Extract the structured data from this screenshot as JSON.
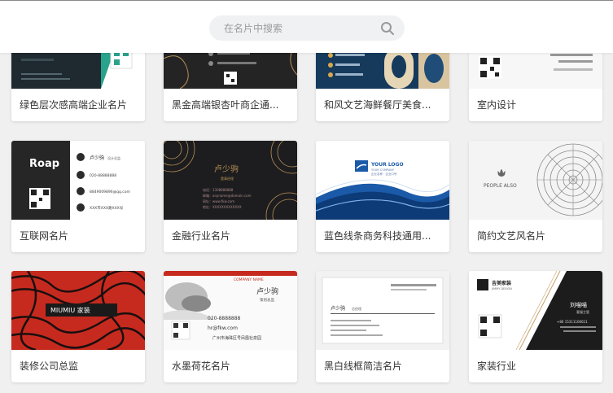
{
  "search": {
    "placeholder": "在名片中搜索"
  },
  "cards": [
    {
      "label": "绿色层次感高端企业名片"
    },
    {
      "label": "黑金高端银杏叶商企通..."
    },
    {
      "label": "和风文艺海鲜餐厅美食..."
    },
    {
      "label": "室内设计"
    },
    {
      "label": "互联网名片",
      "thumb": {
        "logo": "Roap",
        "name": "卢少驹",
        "title": "设计总监",
        "phone": "020-88888888",
        "email": "8849009896@qq.com",
        "address": "XXX市XXX路XXX号"
      }
    },
    {
      "label": "金融行业名片",
      "thumb": {
        "name": "卢少驹",
        "title": "董事经理",
        "phone": "电话：1308888888",
        "email": "邮箱：anyname@domain.com",
        "web": "网址：www.fkw.com",
        "address": "地址：XXXXXXXXXXXXX"
      }
    },
    {
      "label": "蓝色线条商务科技通用...",
      "thumb": {
        "logo": "YOUR LOGO",
        "sub": "YOUR COMPANY",
        "slogan": "企业名称 · 企业口号"
      }
    },
    {
      "label": "简约文艺风名片",
      "thumb": {
        "text": "PEOPLE ALSO"
      }
    },
    {
      "label": "装修公司总监",
      "thumb": {
        "text": "MIUMIU 家装"
      }
    },
    {
      "label": "水墨荷花名片",
      "thumb": {
        "company": "COMPANY NAME",
        "name": "卢少驹",
        "title": "策划总监",
        "phone": "020-8888888",
        "email": "hr@fkw.com",
        "address": "广州市海珠区号凤凰社泉园"
      }
    },
    {
      "label": "黑白线框简洁名片",
      "thumb": {
        "name": "卢少驹",
        "title": "总经理"
      }
    },
    {
      "label": "家装行业",
      "thumb": {
        "brand": "吉美家装",
        "brand_en": "JIMMY DESIGN",
        "name": "刘喵喵",
        "title": "客服主管",
        "phone": "+86 15311100611"
      }
    }
  ],
  "colors": {
    "accent_blue": "#1b5aa8",
    "dark": "#1e1e1e",
    "red": "#c62a1f",
    "gold": "#b69157"
  }
}
